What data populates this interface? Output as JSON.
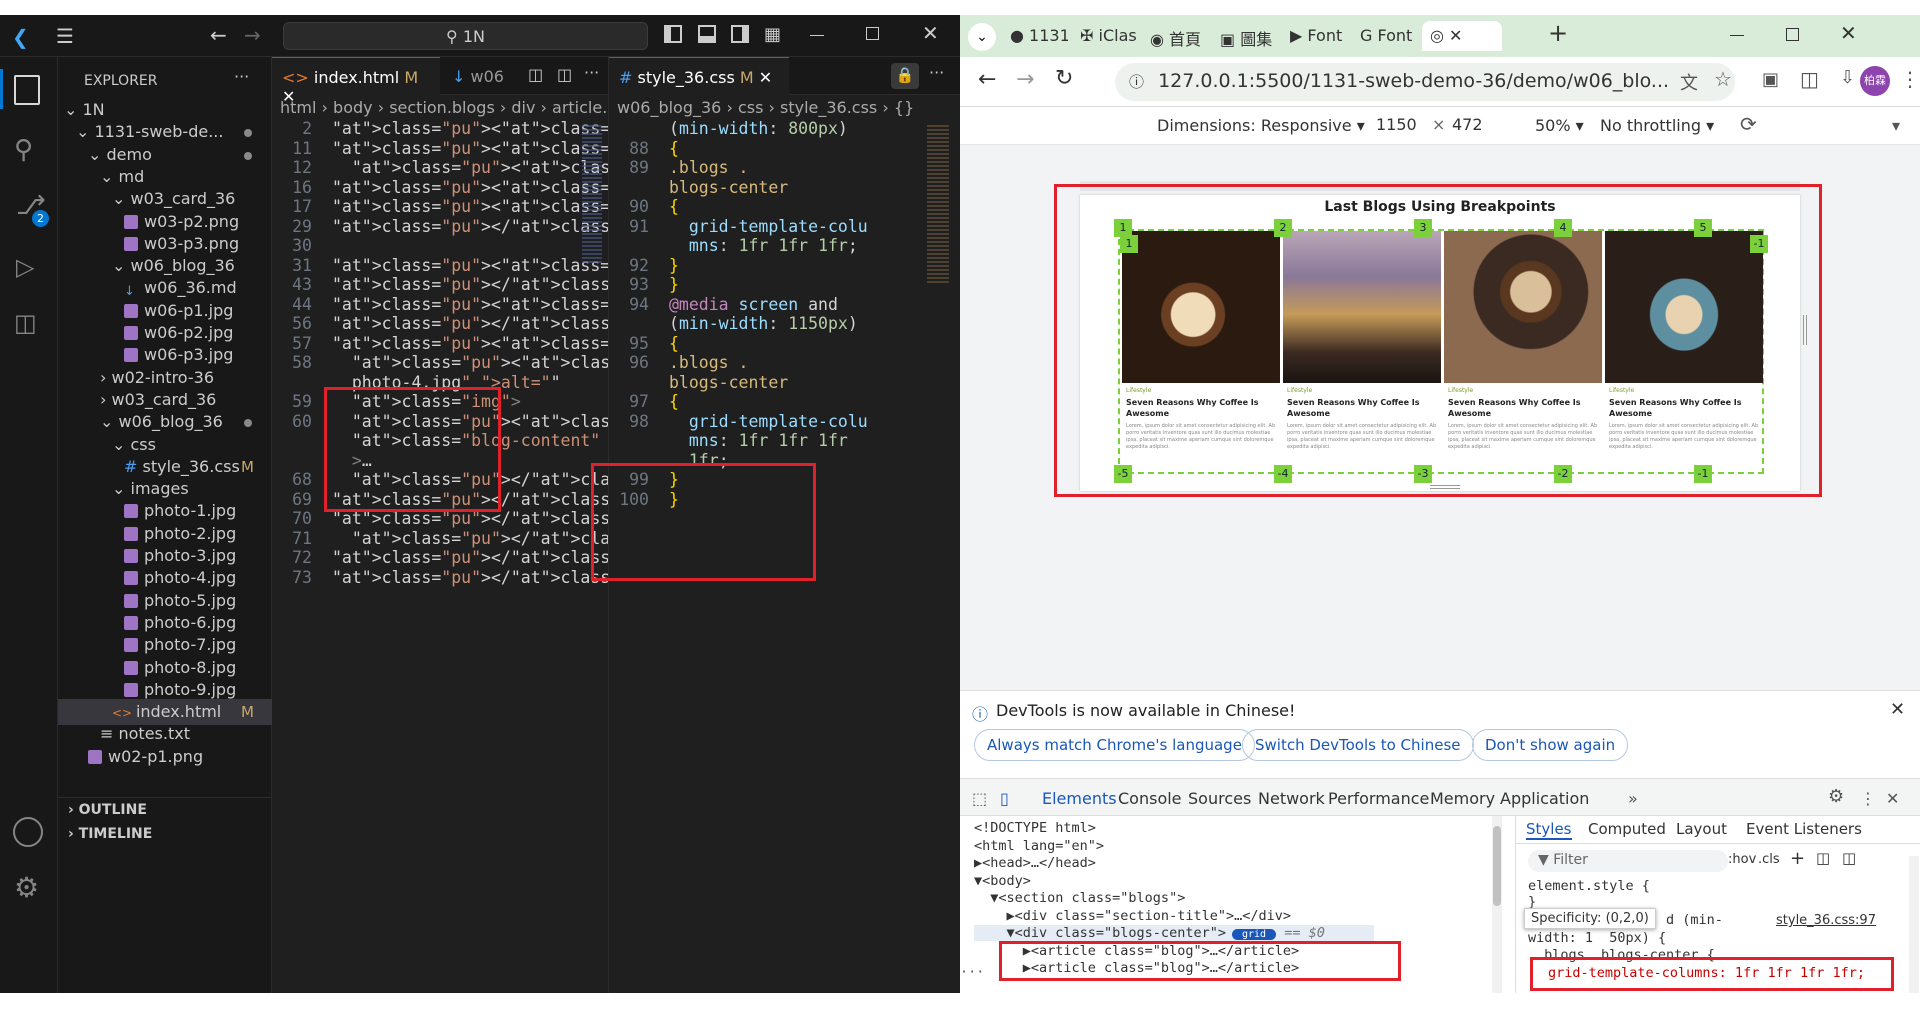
{
  "vscode": {
    "title_search": "1N",
    "explorer_label": "EXPLORER",
    "tree": [
      {
        "label": "1N",
        "depth": 0,
        "kind": "folder-open"
      },
      {
        "label": "1131-sweb-de...",
        "depth": 1,
        "kind": "folder-open",
        "dot": true
      },
      {
        "label": "demo",
        "depth": 2,
        "kind": "folder-open",
        "dot": true
      },
      {
        "label": "md",
        "depth": 3,
        "kind": "folder-open"
      },
      {
        "label": "w03_card_36",
        "depth": 4,
        "kind": "folder-open"
      },
      {
        "label": "w03-p2.png",
        "depth": 5,
        "kind": "img"
      },
      {
        "label": "w03-p3.png",
        "depth": 5,
        "kind": "img"
      },
      {
        "label": "w06_blog_36",
        "depth": 4,
        "kind": "folder-open"
      },
      {
        "label": "w06_36.md",
        "depth": 5,
        "kind": "md"
      },
      {
        "label": "w06-p1.jpg",
        "depth": 5,
        "kind": "img"
      },
      {
        "label": "w06-p2.jpg",
        "depth": 5,
        "kind": "img"
      },
      {
        "label": "w06-p3.jpg",
        "depth": 5,
        "kind": "img"
      },
      {
        "label": "w02-intro-36",
        "depth": 3,
        "kind": "folder"
      },
      {
        "label": "w03_card_36",
        "depth": 3,
        "kind": "folder"
      },
      {
        "label": "w06_blog_36",
        "depth": 3,
        "kind": "folder-open",
        "dot": true
      },
      {
        "label": "css",
        "depth": 4,
        "kind": "folder-open"
      },
      {
        "label": "style_36.css",
        "depth": 5,
        "kind": "css",
        "badge": "M"
      },
      {
        "label": "images",
        "depth": 4,
        "kind": "folder-open"
      },
      {
        "label": "photo-1.jpg",
        "depth": 5,
        "kind": "img"
      },
      {
        "label": "photo-2.jpg",
        "depth": 5,
        "kind": "img"
      },
      {
        "label": "photo-3.jpg",
        "depth": 5,
        "kind": "img"
      },
      {
        "label": "photo-4.jpg",
        "depth": 5,
        "kind": "img"
      },
      {
        "label": "photo-5.jpg",
        "depth": 5,
        "kind": "img"
      },
      {
        "label": "photo-6.jpg",
        "depth": 5,
        "kind": "img"
      },
      {
        "label": "photo-7.jpg",
        "depth": 5,
        "kind": "img"
      },
      {
        "label": "photo-8.jpg",
        "depth": 5,
        "kind": "img"
      },
      {
        "label": "photo-9.jpg",
        "depth": 5,
        "kind": "img"
      },
      {
        "label": "index.html",
        "depth": 4,
        "kind": "html",
        "badge": "M",
        "selected": true
      },
      {
        "label": "notes.txt",
        "depth": 3,
        "kind": "txt"
      },
      {
        "label": "w02-p1.png",
        "depth": 2,
        "kind": "img"
      }
    ],
    "outline_label": "OUTLINE",
    "timeline_label": "TIMELINE",
    "source_control_badge": "2",
    "editor1": {
      "tab1": "index.html",
      "tab1_badge": "M",
      "tab2": "w06",
      "crumbs": [
        "html",
        "body",
        "section.blogs",
        "div",
        "article.blog"
      ],
      "lines": [
        {
          "n": "2",
          "code": "<html lang=\"en\">"
        },
        {
          "n": "11",
          "code": "<body>"
        },
        {
          "n": "12",
          "code": "  <section"
        },
        {
          "n": "16",
          "code": "<div"
        },
        {
          "n": "17",
          "code": "<article class=\"blog\">"
        },
        {
          "n": "29",
          "code": "</article>"
        },
        {
          "n": "30",
          "code": ""
        },
        {
          "n": "31",
          "code": "<article class=\"blog\">"
        },
        {
          "n": "43",
          "code": "</article>"
        },
        {
          "n": "44",
          "code": "<article class=\"blog\">"
        },
        {
          "n": "56",
          "code": "</article>"
        },
        {
          "n": "57",
          "code": "<article class=\"blog\">"
        },
        {
          "n": "58",
          "code": "  <img src=\"./images/"
        },
        {
          "n": "",
          "code": "  photo-4.jpg\" alt=\"\""
        },
        {
          "n": "59",
          "code": "  class=\"img\">"
        },
        {
          "n": "60",
          "code": "  <div"
        },
        {
          "n": "",
          "code": "  class=\"blog-content\""
        },
        {
          "n": "",
          "code": "  >…"
        },
        {
          "n": "68",
          "code": "  </div>"
        },
        {
          "n": "69",
          "code": "</article>"
        },
        {
          "n": "70",
          "code": "</div>"
        },
        {
          "n": "71",
          "code": "  </section>"
        },
        {
          "n": "72",
          "code": "</body>"
        },
        {
          "n": "73",
          "code": "</html>"
        }
      ]
    },
    "editor2": {
      "tab": "style_36.css",
      "tab_badge": "M",
      "crumbs": [
        "w06_blog_36",
        "css",
        "style_36.css",
        "{}"
      ],
      "lines": [
        {
          "n": "",
          "code": "(min-width: 800px)"
        },
        {
          "n": "88",
          "code": "{"
        },
        {
          "n": "89",
          "code": ".blogs ."
        },
        {
          "n": "",
          "code": "blogs-center"
        },
        {
          "n": "90",
          "code": "{"
        },
        {
          "n": "91",
          "code": "  grid-template-colu"
        },
        {
          "n": "",
          "code": "  mns: 1fr 1fr 1fr;"
        },
        {
          "n": "92",
          "code": "}"
        },
        {
          "n": "93",
          "code": "}"
        },
        {
          "n": "94",
          "code": "@media screen and"
        },
        {
          "n": "",
          "code": "(min-width: 1150px)"
        },
        {
          "n": "95",
          "code": "{"
        },
        {
          "n": "96",
          "code": ".blogs ."
        },
        {
          "n": "",
          "code": "blogs-center"
        },
        {
          "n": "97",
          "code": "{"
        },
        {
          "n": "98",
          "code": "  grid-template-colu"
        },
        {
          "n": "",
          "code": "  mns: 1fr 1fr 1fr"
        },
        {
          "n": "",
          "code": "  1fr;"
        },
        {
          "n": "99",
          "code": "}"
        },
        {
          "n": "100",
          "code": "}"
        }
      ]
    }
  },
  "chrome": {
    "tabs": [
      "1131",
      "iClas",
      "首頁",
      "圖集",
      "Font",
      "Font",
      ""
    ],
    "url": "127.0.0.1:5500/1131-sweb-demo-36/demo/w06_blo...",
    "avatar": "柏霖",
    "devbar": {
      "dimensions": "Dimensions: Responsive",
      "width": "1150",
      "height": "472",
      "zoom": "50%",
      "throttle": "No throttling"
    },
    "page": {
      "heading": "Last Blogs Using Breakpoints",
      "cards": [
        {
          "category": "Lifestyle",
          "title": "Seven Reasons Why Coffee Is Awesome",
          "text": "Lorem, ipsum dolor sit amet consectetur adipisicing elit. Ab porro veritatis inventore quas sunt illo ducimus molestiae ipsa, placeat sit maxime aperiam cumque sint doloremque expedita adipisci."
        },
        {
          "category": "Lifestyle",
          "title": "Seven Reasons Why Coffee Is Awesome",
          "text": "Lorem, ipsum dolor sit amet consectetur adipisicing elit. Ab porro veritatis inventore quas sunt illo ducimus molestiae ipsa, placeat sit maxime aperiam cumque sint doloremque expedita adipisci."
        },
        {
          "category": "Lifestyle",
          "title": "Seven Reasons Why Coffee Is Awesome",
          "text": "Lorem, ipsum dolor sit amet consectetur adipisicing elit. Ab porro veritatis inventore quas sunt illo ducimus molestiae ipsa, placeat sit maxime aperiam cumque sint doloremque expedita adipisci."
        },
        {
          "category": "Lifestyle",
          "title": "Seven Reasons Why Coffee Is Awesome",
          "text": "Lorem, ipsum dolor sit amet consectetur adipisicing elit. Ab porro veritatis inventore quas sunt illo ducimus molestiae ipsa, placeat sit maxime aperiam cumque sint doloremque expedita adipisci."
        }
      ],
      "grid_top_numbers": [
        "1",
        "2",
        "3",
        "4",
        "5"
      ],
      "grid_inner_top": [
        "1",
        "-1"
      ],
      "grid_bottom_numbers": [
        "-5",
        "-4",
        "-3",
        "-2",
        "-1"
      ]
    },
    "notice": {
      "message": "DevTools is now available in Chinese!",
      "btn1": "Always match Chrome's language",
      "btn2": "Switch DevTools to Chinese",
      "btn3": "Don't show again"
    },
    "devtabs": [
      "Elements",
      "Console",
      "Sources",
      "Network",
      "Performance",
      "Memory",
      "Application"
    ],
    "elements": [
      "<!DOCTYPE html>",
      "<html lang=\"en\">",
      "▶<head>…</head>",
      "▼<body>",
      "  ▼<section class=\"blogs\">",
      "    ▶<div class=\"section-title\">…</div>",
      "    ▼<div class=\"blogs-center\">",
      "      ▶<article class=\"blog\">…</article>",
      "      ▶<article class=\"blog\">…</article>"
    ],
    "grid_badge": "grid",
    "eq_dollar": "== $0",
    "styles_tabs": [
      "Styles",
      "Computed",
      "Layout",
      "Event Listeners"
    ],
    "filter_placeholder": "Filter",
    "hov": ":hov",
    "cls": ".cls",
    "element_style": "element.style {",
    "element_close": "}",
    "specificity": "Specificity: (0,2,0)",
    "media_frag": "d (min-",
    "width_frag": "width: 1  50px) {",
    "rule_frag": ".blogs .blogs-center {",
    "source": "style_36.css:97",
    "decl": "grid-template-columns: 1fr 1fr 1fr 1fr;"
  }
}
